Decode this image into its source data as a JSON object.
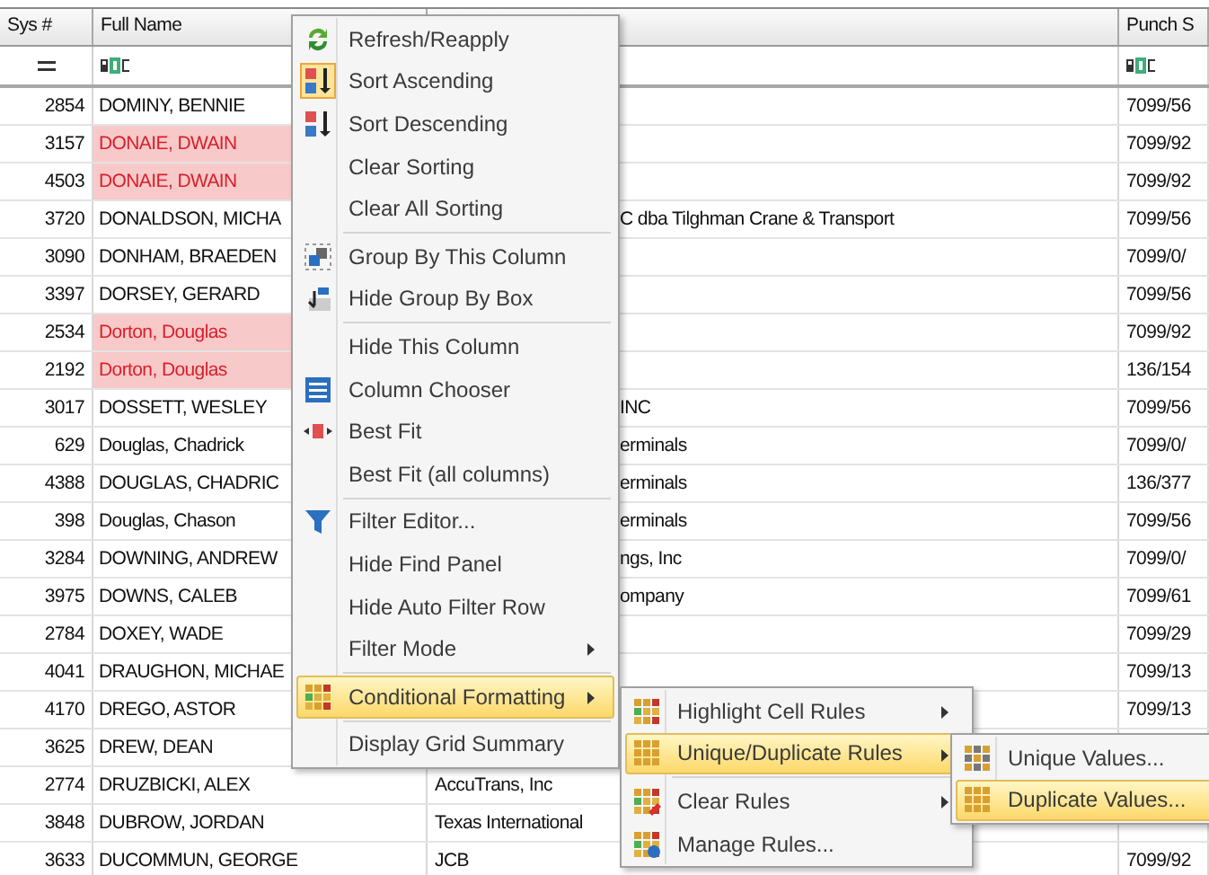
{
  "grid": {
    "columns": [
      {
        "header": "Sys #",
        "kind": "equals"
      },
      {
        "header": "Full Name",
        "kind": "text"
      },
      {
        "kind": "plain"
      },
      {
        "header": "Punch S",
        "kind": "text"
      }
    ],
    "rows": [
      {
        "sys": "2854",
        "name": "DOMINY, BENNIE",
        "duplicate": false,
        "punch": "7099/56"
      },
      {
        "sys": "3157",
        "name": "DONAIE, DWAIN",
        "duplicate": true,
        "punch": "7099/92"
      },
      {
        "sys": "4503",
        "name": "DONAIE, DWAIN",
        "duplicate": true,
        "punch": "7099/92"
      },
      {
        "sys": "3720",
        "name": "DONALDSON, MICHA",
        "duplicate": false,
        "column_3": "C dba Tilghman Crane & Transport",
        "column_3_covered": true,
        "punch": "7099/56"
      },
      {
        "sys": "3090",
        "name": "DONHAM, BRAEDEN",
        "duplicate": false,
        "punch": "7099/0/"
      },
      {
        "sys": "3397",
        "name": "DORSEY, GERARD",
        "duplicate": false,
        "punch": "7099/56"
      },
      {
        "sys": "2534",
        "name": "Dorton, Douglas",
        "duplicate": true,
        "punch": "7099/92"
      },
      {
        "sys": "2192",
        "name": "Dorton, Douglas",
        "duplicate": true,
        "punch": "136/154"
      },
      {
        "sys": "3017",
        "name": "DOSSETT, WESLEY",
        "duplicate": false,
        "column_3": "INC",
        "column_3_covered": true,
        "punch": "7099/56"
      },
      {
        "sys": "629",
        "name": "Douglas, Chadrick",
        "duplicate": false,
        "column_3": "erminals",
        "column_3_covered": true,
        "punch": "7099/0/"
      },
      {
        "sys": "4388",
        "name": "DOUGLAS, CHADRIC",
        "duplicate": false,
        "column_3": "erminals",
        "column_3_covered": true,
        "punch": "136/377"
      },
      {
        "sys": "398",
        "name": "Douglas, Chason",
        "duplicate": false,
        "column_3": "erminals",
        "column_3_covered": true,
        "punch": "7099/56"
      },
      {
        "sys": "3284",
        "name": "DOWNING, ANDREW",
        "duplicate": false,
        "column_3": "ngs, Inc",
        "column_3_covered": true,
        "punch": "7099/0/"
      },
      {
        "sys": "3975",
        "name": "DOWNS, CALEB",
        "duplicate": false,
        "column_3": "ompany",
        "column_3_covered": true,
        "punch": "7099/61"
      },
      {
        "sys": "2784",
        "name": "DOXEY, WADE",
        "duplicate": false,
        "punch": "7099/29"
      },
      {
        "sys": "4041",
        "name": "DRAUGHON, MICHAE",
        "duplicate": false,
        "punch": "7099/13"
      },
      {
        "sys": "4170",
        "name": "DREGO, ASTOR",
        "duplicate": false,
        "punch": "7099/13"
      },
      {
        "sys": "3625",
        "name": "DREW, DEAN",
        "duplicate": false
      },
      {
        "sys": "2774",
        "name": "DRUZBICKI, ALEX",
        "duplicate": false,
        "column_3": "AccuTrans, Inc",
        "column_3_covered": false
      },
      {
        "sys": "3848",
        "name": "DUBROW, JORDAN",
        "duplicate": false,
        "column_3": "Texas International",
        "column_3_covered": false
      },
      {
        "sys": "3633",
        "name": "DUCOMMUN, GEORGE",
        "duplicate": false,
        "column_3": "JCB",
        "column_3_covered": false,
        "punch": "7099/92"
      }
    ]
  },
  "column_menu": {
    "items": [
      {
        "label": "Refresh/Reapply",
        "checked": false,
        "selected": false,
        "submenu": false,
        "separator_before": false
      },
      {
        "label": "Sort Ascending",
        "checked": true,
        "selected": false,
        "submenu": false,
        "separator_before": false
      },
      {
        "label": "Sort Descending",
        "checked": false,
        "selected": false,
        "submenu": false,
        "separator_before": false
      },
      {
        "label": "Clear Sorting",
        "checked": false,
        "selected": false,
        "submenu": false,
        "separator_before": false
      },
      {
        "label": "Clear All Sorting",
        "checked": false,
        "selected": false,
        "submenu": false,
        "separator_before": false
      },
      {
        "label": "Group By This Column",
        "checked": false,
        "selected": false,
        "submenu": false,
        "separator_before": true
      },
      {
        "label": "Hide Group By Box",
        "checked": false,
        "selected": false,
        "submenu": false,
        "separator_before": false
      },
      {
        "label": "Hide This Column",
        "checked": false,
        "selected": false,
        "submenu": false,
        "separator_before": true
      },
      {
        "label": "Column Chooser",
        "checked": false,
        "selected": false,
        "submenu": false,
        "separator_before": false
      },
      {
        "label": "Best Fit",
        "checked": false,
        "selected": false,
        "submenu": false,
        "separator_before": false
      },
      {
        "label": "Best Fit (all columns)",
        "checked": false,
        "selected": false,
        "submenu": false,
        "separator_before": false
      },
      {
        "label": "Filter Editor...",
        "checked": false,
        "selected": false,
        "submenu": false,
        "separator_before": true
      },
      {
        "label": "Hide Find Panel",
        "checked": false,
        "selected": false,
        "submenu": false,
        "separator_before": false
      },
      {
        "label": "Hide Auto Filter Row",
        "checked": false,
        "selected": false,
        "submenu": false,
        "separator_before": false
      },
      {
        "label": "Filter Mode",
        "checked": false,
        "selected": false,
        "submenu": true,
        "separator_before": false
      },
      {
        "label": "Conditional Formatting",
        "checked": false,
        "selected": true,
        "submenu": true,
        "separator_before": true
      },
      {
        "label": "Display Grid Summary",
        "checked": false,
        "selected": false,
        "submenu": false,
        "separator_before": true
      }
    ]
  },
  "formatting_menu": {
    "items": [
      {
        "label": "Highlight Cell Rules",
        "selected": false,
        "submenu": true,
        "separator_before": false
      },
      {
        "label": "Unique/Duplicate Rules",
        "selected": true,
        "submenu": true,
        "separator_before": false
      },
      {
        "label": "Clear Rules",
        "selected": false,
        "submenu": true,
        "separator_before": true
      },
      {
        "label": "Manage Rules...",
        "selected": false,
        "submenu": false,
        "separator_before": false
      }
    ]
  },
  "duplicate_menu": {
    "items": [
      {
        "label": "Unique Values...",
        "selected": false
      },
      {
        "label": "Duplicate Values...",
        "selected": true
      }
    ]
  }
}
